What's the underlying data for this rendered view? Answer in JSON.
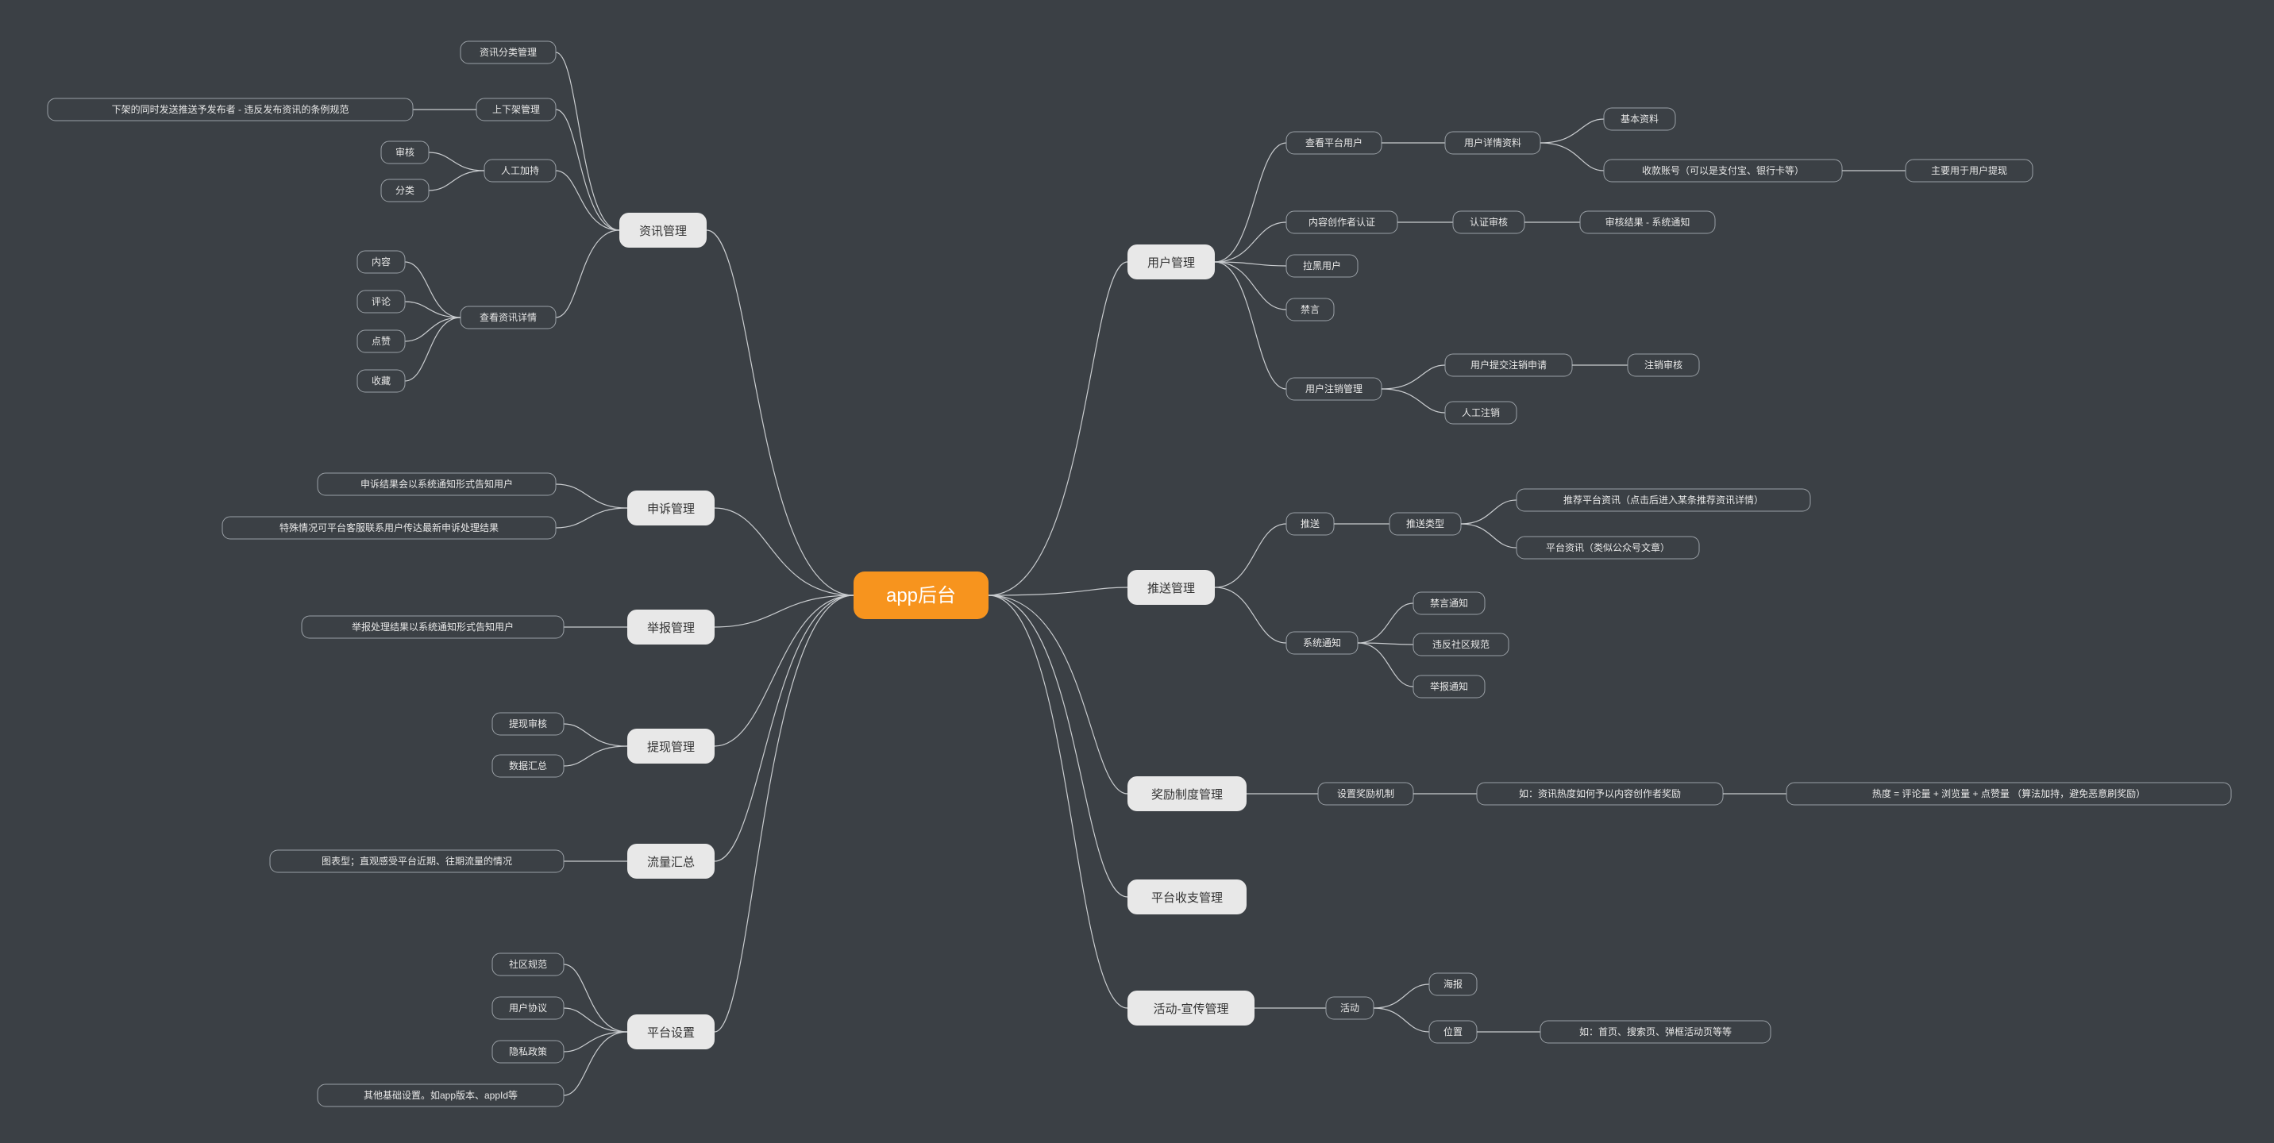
{
  "root": "app后台",
  "left": {
    "info_mgmt": {
      "label": "资讯管理",
      "children": {
        "category": "资讯分类管理",
        "onoff": {
          "label": "上下架管理",
          "child": "下架的同时发送推送予发布者 - 违反发布资讯的条例规范"
        },
        "manual": {
          "label": "人工加持",
          "children": [
            "审核",
            "分类"
          ]
        },
        "detail": {
          "label": "查看资讯详情",
          "children": [
            "内容",
            "评论",
            "点赞",
            "收藏"
          ]
        }
      }
    },
    "appeal_mgmt": {
      "label": "申诉管理",
      "children": [
        "申诉结果会以系统通知形式告知用户",
        "特殊情况可平台客服联系用户传达最新申诉处理结果"
      ]
    },
    "report_mgmt": {
      "label": "举报管理",
      "children": [
        "举报处理结果以系统通知形式告知用户"
      ]
    },
    "withdraw_mgmt": {
      "label": "提现管理",
      "children": [
        "提现审核",
        "数据汇总"
      ]
    },
    "traffic": {
      "label": "流量汇总",
      "children": [
        "图表型；直观感受平台近期、往期流量的情况"
      ]
    },
    "platform_setting": {
      "label": "平台设置",
      "children": [
        "社区规范",
        "用户协议",
        "隐私政策",
        "其他基础设置。如app版本、appId等"
      ]
    }
  },
  "right": {
    "user_mgmt": {
      "label": "用户管理",
      "children": {
        "view_user": {
          "label": "查看平台用户",
          "detail": {
            "label": "用户详情资料",
            "basic": "基本资料",
            "account": {
              "label": "收款账号（可以是支付宝、银行卡等）",
              "note": "主要用于用户提现"
            }
          }
        },
        "creator_cert": {
          "label": "内容创作者认证",
          "audit": {
            "label": "认证审核",
            "result": "审核结果 - 系统通知"
          }
        },
        "blacklist": "拉黑用户",
        "mute": "禁言",
        "deactivate": {
          "label": "用户注销管理",
          "apply": {
            "label": "用户提交注销申请",
            "audit": "注销审核"
          },
          "manual": "人工注销"
        }
      }
    },
    "push_mgmt": {
      "label": "推送管理",
      "push": {
        "label": "推送",
        "type": {
          "label": "推送类型",
          "rec": "推荐平台资讯（点击后进入某条推荐资讯详情）",
          "plat": "平台资讯（类似公众号文章）"
        }
      },
      "sys_notify": {
        "label": "系统通知",
        "children": [
          "禁言通知",
          "违反社区规范",
          "举报通知"
        ]
      }
    },
    "reward_mgmt": {
      "label": "奖励制度管理",
      "set": {
        "label": "设置奖励机制",
        "eg": {
          "label": "如：资讯热度如何予以内容创作者奖励",
          "formula": "热度 = 评论量 + 浏览量 + 点赞量 （算法加持，避免恶意刷奖励）"
        }
      }
    },
    "finance_mgmt": {
      "label": "平台收支管理"
    },
    "activity_mgmt": {
      "label": "活动-宣传管理",
      "activity": {
        "label": "活动",
        "poster": "海报",
        "pos": {
          "label": "位置",
          "note": "如：首页、搜索页、弹框活动页等等"
        }
      }
    }
  }
}
